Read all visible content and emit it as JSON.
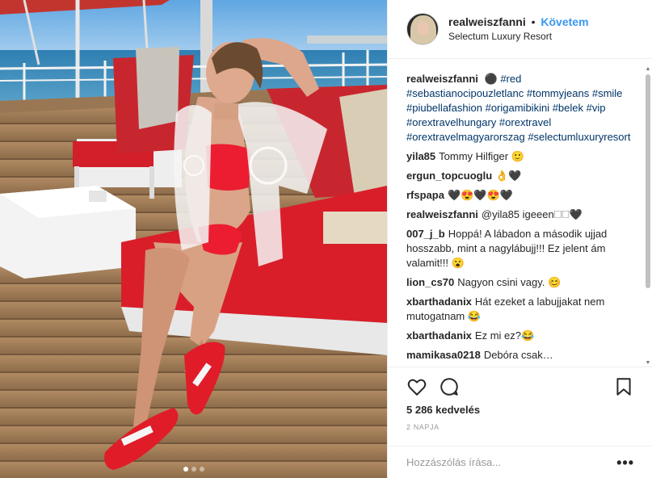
{
  "post": {
    "author": "realweiszfanni",
    "separator": "•",
    "follow_label": "Követem",
    "location": "Selectum Luxury Resort",
    "caption": {
      "author": "realweiszfanni",
      "emoji": "⚫",
      "hashtags": [
        "#red",
        "#sebastianocipouzletlanc",
        "#tommyjeans",
        "#smile",
        "#piubellafashion",
        "#origamibikini",
        "#belek",
        "#vip",
        "#orextravelhungary",
        "#orextravel",
        "#orextravelmagyarorszag",
        "#selectumluxuryresort"
      ]
    },
    "comments": [
      {
        "author": "yila85",
        "text": "Tommy Hilfiger 🙂"
      },
      {
        "author": "ergun_topcuoglu",
        "text": "👌🖤"
      },
      {
        "author": "rfspapa",
        "text": "🖤😍🖤😍🖤"
      },
      {
        "author": "realweiszfanni",
        "text": "@yila85 igeeen🗆🗆🖤"
      },
      {
        "author": "007_j_b",
        "text": "Hoppá! A lábadon a második ujjad hosszabb, mint a nagylábujj!!! Ez jelent ám valamit!!! 😮"
      },
      {
        "author": "lion_cs70",
        "text": "Nagyon csini vagy. 😊"
      },
      {
        "author": "xbarthadanix",
        "text": "Hát ezeket a labujjakat nem mutogatnam 😂"
      },
      {
        "author": "xbarthadanix",
        "text": "Ez mi ez?😂"
      },
      {
        "author": "mamikasa0218",
        "text": "Debóra csak…"
      }
    ],
    "likes": "5 286 kedvelés",
    "timestamp": "2 NAPJA",
    "comment_placeholder": "Hozzászólás írása...",
    "more_label": "•••",
    "carousel": {
      "count": 3,
      "active_index": 0
    }
  },
  "icons": {
    "like": "heart-icon",
    "comment": "comment-bubble-icon",
    "save": "bookmark-icon",
    "more": "ellipsis-icon"
  },
  "colors": {
    "link": "#3897f0",
    "hashtag": "#003569",
    "muted": "#999999",
    "border": "#efefef"
  },
  "scrollbar": {
    "up_glyph": "▲",
    "down_glyph": "▼"
  }
}
